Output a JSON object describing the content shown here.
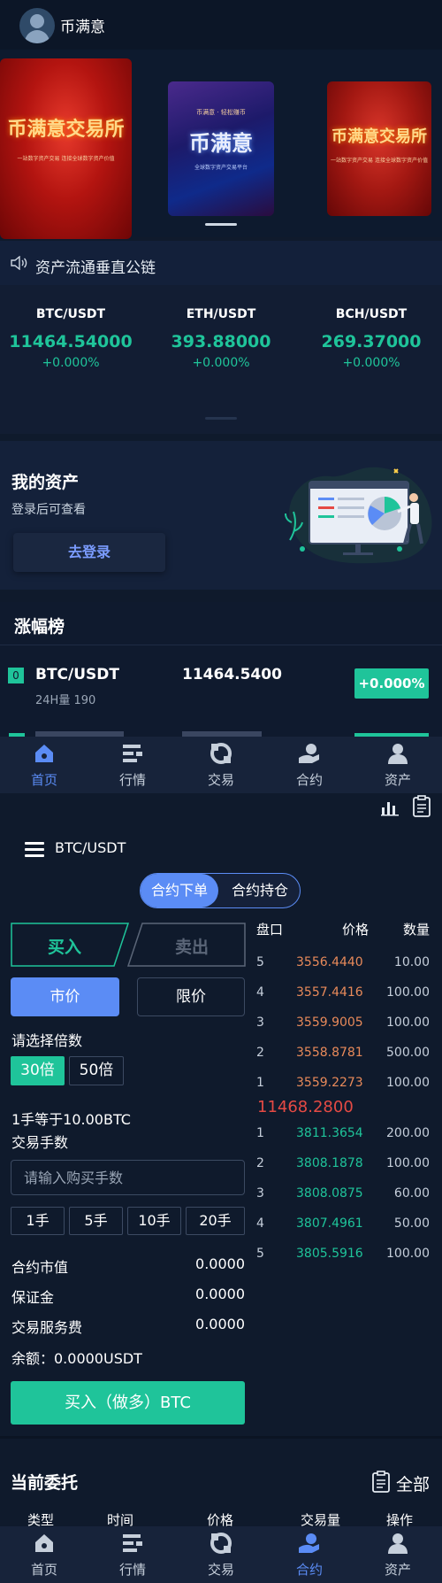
{
  "header": {
    "brand": "币满意"
  },
  "banner": {
    "cards": [
      {
        "title": "币满意交易所",
        "subtitle": "一站数字资产交易 连接全球数字资产价值"
      },
      {
        "title": "币满意",
        "tag": "币满意 · 轻松赚币",
        "subtitle": "全球数字资产交易平台"
      },
      {
        "title": "币满意交易所",
        "subtitle": "一站数字资产交易 连接全球数字资产价值"
      }
    ]
  },
  "notice": {
    "text": "资产流通垂直公链"
  },
  "tickers": [
    {
      "pair": "BTC/USDT",
      "price": "11464.54000",
      "change": "+0.000%"
    },
    {
      "pair": "ETH/USDT",
      "price": "393.88000",
      "change": "+0.000%"
    },
    {
      "pair": "BCH/USDT",
      "price": "269.37000",
      "change": "+0.000%"
    }
  ],
  "assets": {
    "title": "我的资产",
    "subtitle": "登录后可查看",
    "login_label": "去登录"
  },
  "gainers": {
    "title": "涨幅榜",
    "rows": [
      {
        "rank": "0",
        "pair": "BTC/USDT",
        "volume": "24H量 190",
        "price": "11464.5400",
        "change": "+0.000%"
      }
    ]
  },
  "tabbar": {
    "tabs": [
      {
        "label": "首页",
        "icon": "home-icon"
      },
      {
        "label": "行情",
        "icon": "market-icon"
      },
      {
        "label": "交易",
        "icon": "trade-icon"
      },
      {
        "label": "合约",
        "icon": "contract-icon"
      },
      {
        "label": "资产",
        "icon": "assets-icon"
      }
    ],
    "first_active": "首页",
    "second_active": "合约"
  },
  "contract": {
    "pair": "BTC/USDT",
    "segments": [
      "合约下单",
      "合约持仓"
    ],
    "buy_label": "买入",
    "sell_label": "卖出",
    "market_label": "市价",
    "limit_label": "限价",
    "leverage_title": "请选择倍数",
    "leverages": [
      "30倍",
      "50倍"
    ],
    "lot_equals": "1手等于10.00BTC",
    "lot_title": "交易手数",
    "lot_placeholder": "请输入购买手数",
    "lots": [
      "1手",
      "5手",
      "10手",
      "20手"
    ],
    "summary": [
      {
        "label": "合约市值",
        "value": "0.0000"
      },
      {
        "label": "保证金",
        "value": "0.0000"
      },
      {
        "label": "交易服务费",
        "value": "0.0000"
      }
    ],
    "balance": "余额：0.0000USDT",
    "submit_label": "买入（做多）BTC"
  },
  "orderbook": {
    "headers": [
      "盘口",
      "价格",
      "数量"
    ],
    "asks": [
      {
        "n": "5",
        "price": "3556.4440",
        "qty": "10.00"
      },
      {
        "n": "4",
        "price": "3557.4416",
        "qty": "100.00"
      },
      {
        "n": "3",
        "price": "3559.9005",
        "qty": "100.00"
      },
      {
        "n": "2",
        "price": "3558.8781",
        "qty": "500.00"
      },
      {
        "n": "1",
        "price": "3559.2273",
        "qty": "100.00"
      }
    ],
    "last_price": "11468.2800",
    "bids": [
      {
        "n": "1",
        "price": "3811.3654",
        "qty": "200.00"
      },
      {
        "n": "2",
        "price": "3808.1878",
        "qty": "100.00"
      },
      {
        "n": "3",
        "price": "3808.0875",
        "qty": "60.00"
      },
      {
        "n": "4",
        "price": "3807.4961",
        "qty": "50.00"
      },
      {
        "n": "5",
        "price": "3805.5916",
        "qty": "100.00"
      }
    ]
  },
  "current_orders": {
    "title": "当前委托",
    "all_label": "全部",
    "headers": [
      "类型",
      "时间",
      "价格",
      "交易量",
      "操作"
    ]
  },
  "colors": {
    "accent": "#5b8cf5",
    "up": "#1fc49a",
    "down": "#e54a44",
    "ask_price": "#e88a5a",
    "bid_price": "#1fc49a"
  }
}
